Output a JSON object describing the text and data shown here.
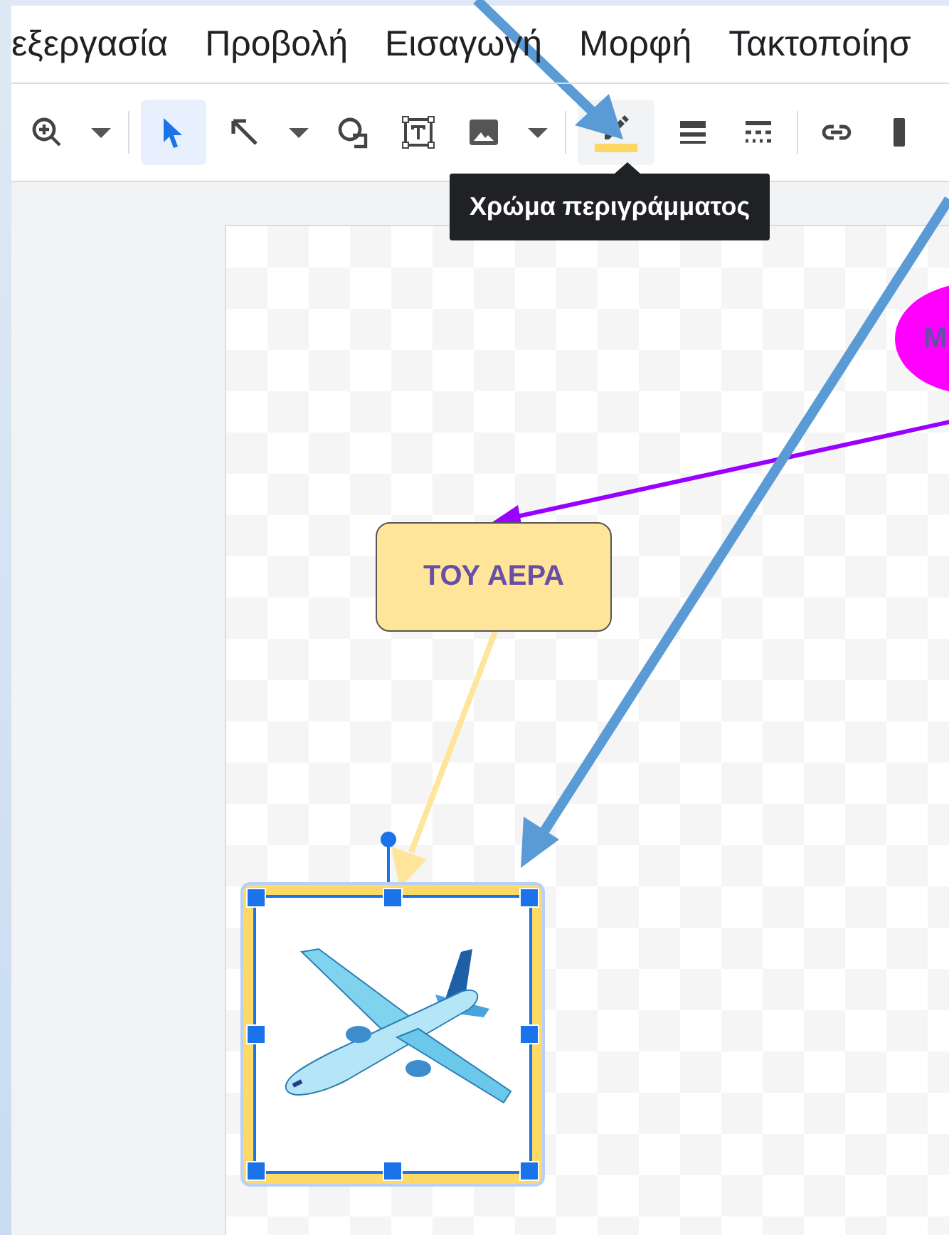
{
  "menu": [
    {
      "label": "εξεργασία"
    },
    {
      "label": "Προβολή"
    },
    {
      "label": "Εισαγωγή"
    },
    {
      "label": "Μορφή"
    },
    {
      "label": "Τακτοποίησ"
    }
  ],
  "toolbar": {
    "groups": [
      [
        {
          "kind": "zoom",
          "selected": false,
          "hovered": false
        },
        {
          "kind": "caret",
          "selected": false,
          "hovered": false
        }
      ],
      [
        {
          "kind": "select",
          "selected": true,
          "hovered": false
        },
        {
          "kind": "line",
          "selected": false,
          "hovered": false
        },
        {
          "kind": "caret",
          "selected": false,
          "hovered": false
        },
        {
          "kind": "shape",
          "selected": false,
          "hovered": false
        },
        {
          "kind": "textbox",
          "selected": false,
          "hovered": false
        },
        {
          "kind": "image",
          "selected": false,
          "hovered": false
        },
        {
          "kind": "caret",
          "selected": false,
          "hovered": false
        }
      ],
      [
        {
          "kind": "border-color",
          "selected": false,
          "hovered": true
        },
        {
          "kind": "border-weight",
          "selected": false,
          "hovered": false
        },
        {
          "kind": "border-dash",
          "selected": false,
          "hovered": false
        }
      ],
      [
        {
          "kind": "link",
          "selected": false,
          "hovered": false
        },
        {
          "kind": "more",
          "selected": false,
          "hovered": false
        }
      ]
    ]
  },
  "tooltip": {
    "text": "Χρώμα περιγράμματος"
  },
  "canvas": {
    "shapes": [
      {
        "kind": "ellipse",
        "text": "M"
      },
      {
        "kind": "box",
        "text": "ΤΟΥ ΑΕΡΑ"
      },
      {
        "kind": "image",
        "selected": true
      }
    ]
  }
}
